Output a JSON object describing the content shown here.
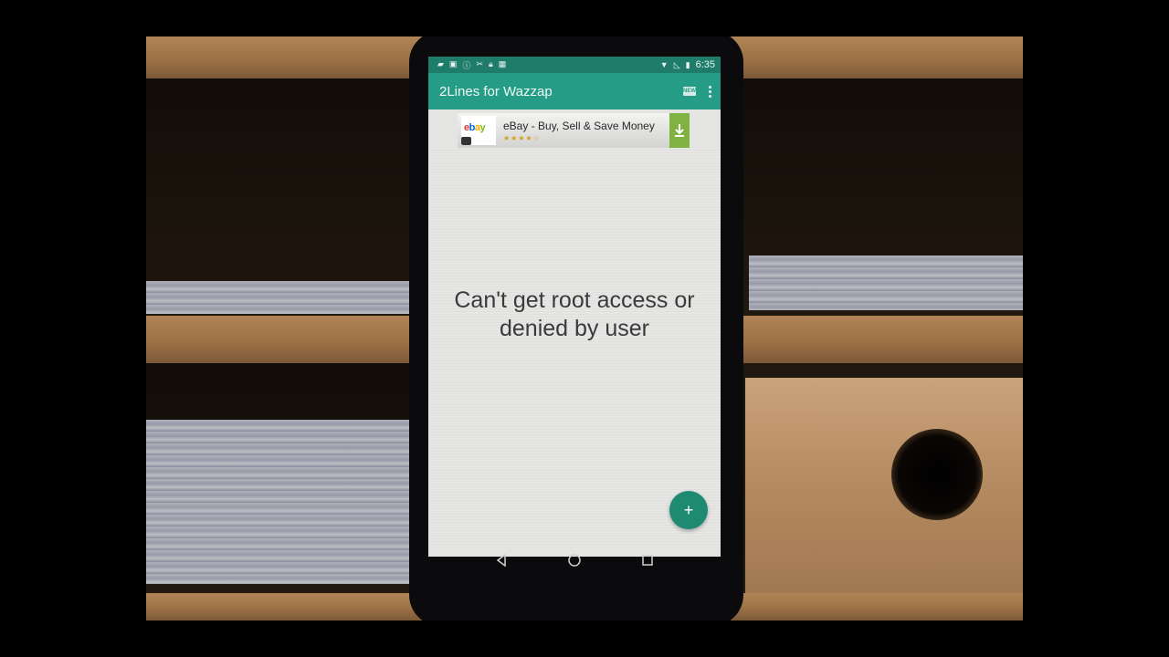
{
  "status_bar": {
    "left_icons": [
      "image-icon",
      "facebook-icon",
      "info-icon",
      "tools-icon",
      "lock-icon",
      "android-icon"
    ],
    "right_icons": [
      "wifi-icon",
      "signal-icon",
      "battery-icon"
    ],
    "time": "6:35"
  },
  "app_bar": {
    "title": "2Lines for Wazzap",
    "new_badge": "NEW",
    "more_icon": "more-vert-icon"
  },
  "ad": {
    "title": "eBay - Buy, Sell & Save Money",
    "logo_letters": [
      "e",
      "b",
      "a",
      "y"
    ],
    "stars": "★★★★☆",
    "download_icon": "download-icon"
  },
  "main": {
    "message": "Can't get root access or denied by user"
  },
  "fab": {
    "label": "+"
  },
  "nav": {
    "items": [
      "back-icon",
      "home-icon",
      "recents-icon"
    ]
  },
  "colors": {
    "status_bar": "#1f7b6a",
    "app_bar": "#259d86",
    "fab": "#1e8a72",
    "ad_download": "#7fb241"
  }
}
